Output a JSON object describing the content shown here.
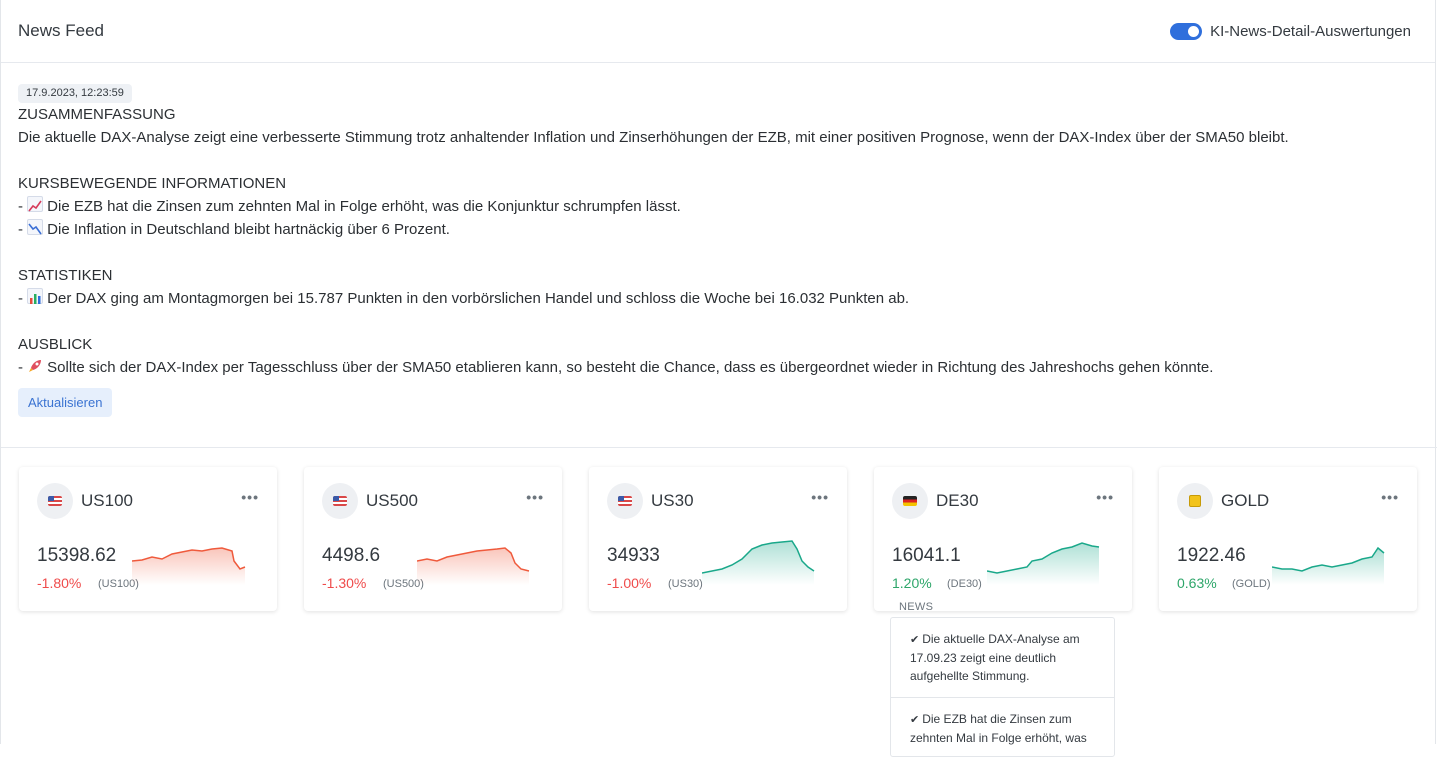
{
  "header": {
    "title": "News Feed",
    "toggle_label": "KI-News-Detail-Auswertungen",
    "toggle_on": true,
    "toggle_color": "#2f6fdc"
  },
  "feed": {
    "timestamp": "17.9.2023, 12:23:59",
    "summary_heading": "ZUSAMMENFASSUNG",
    "summary_text": "Die aktuelle DAX-Analyse zeigt eine verbesserte Stimmung trotz anhaltender Inflation und Zinserhöhungen der EZB, mit einer positiven Prognose, wenn der DAX-Index über der SMA50 bleibt.",
    "info_heading": "KURSBEWEGENDE INFORMATIONEN",
    "info_items": [
      {
        "prefix": "- ",
        "icon": "chart-increasing-icon",
        "text": "Die EZB hat die Zinsen zum zehnten Mal in Folge erhöht, was die Konjunktur schrumpfen lässt."
      },
      {
        "prefix": "- ",
        "icon": "chart-decreasing-icon",
        "text": "Die Inflation in Deutschland bleibt hartnäckig über 6 Prozent."
      }
    ],
    "stats_heading": "STATISTIKEN",
    "stats_items": [
      {
        "prefix": "- ",
        "icon": "bar-chart-icon",
        "text": "Der DAX ging am Montagmorgen bei 15.787 Punkten in den vorbörslichen Handel und schloss die Woche bei 16.032 Punkten ab."
      }
    ],
    "outlook_heading": "AUSBLICK",
    "outlook_items": [
      {
        "prefix": "- ",
        "icon": "rocket-icon",
        "text": "Sollte sich der DAX-Index per Tagesschluss über der SMA50 etablieren kann, so besteht die Chance, dass es übergeordnet wieder in Richtung des Jahreshochs gehen könnte."
      }
    ],
    "refresh_label": "Aktualisieren"
  },
  "cards": [
    {
      "symbol": "US100",
      "flag": "us-flag-icon",
      "price": "15398.62",
      "change": "-1.80%",
      "tag": "(US100)",
      "trend": "down",
      "color": "#ef5a3c"
    },
    {
      "symbol": "US500",
      "flag": "us-flag-icon",
      "price": "4498.6",
      "change": "-1.30%",
      "tag": "(US500)",
      "trend": "down",
      "color": "#ef5a3c"
    },
    {
      "symbol": "US30",
      "flag": "us-flag-icon",
      "price": "34933",
      "change": "-1.00%",
      "tag": "(US30)",
      "trend": "down",
      "color": "#1aa88a"
    },
    {
      "symbol": "DE30",
      "flag": "de-flag-icon",
      "price": "16041.1",
      "change": "1.20%",
      "tag": "(DE30)",
      "trend": "up",
      "color": "#1aa88a"
    },
    {
      "symbol": "GOLD",
      "flag": "gold-icon",
      "price": "1922.46",
      "change": "0.63%",
      "tag": "(GOLD)",
      "trend": "up",
      "color": "#1aa88a"
    }
  ],
  "news": {
    "label": "NEWS",
    "items": [
      "Die aktuelle DAX-Analyse am 17.09.23 zeigt eine deutlich aufgehellte Stimmung.",
      "Die EZB hat die Zinsen zum zehnten Mal in Folge erhöht, was"
    ]
  }
}
